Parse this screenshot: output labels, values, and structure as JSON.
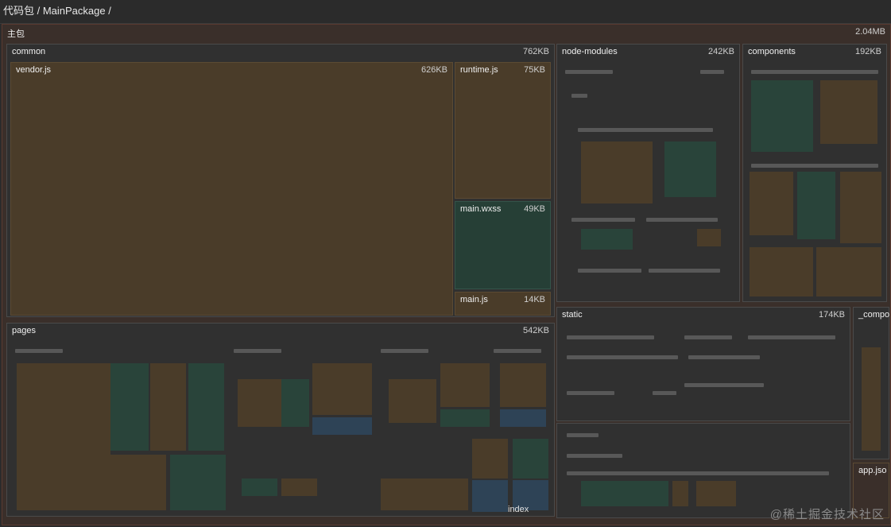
{
  "breadcrumb": "代码包 / MainPackage /",
  "root": {
    "label": "主包",
    "size": "2.04MB"
  },
  "common": {
    "label": "common",
    "size": "762KB",
    "vendor": {
      "label": "vendor.js",
      "size": "626KB"
    },
    "runtime": {
      "label": "runtime.js",
      "size": "75KB"
    },
    "mainwxss": {
      "label": "main.wxss",
      "size": "49KB"
    },
    "mainjs": {
      "label": "main.js",
      "size": "14KB"
    }
  },
  "node_modules": {
    "label": "node-modules",
    "size": "242KB"
  },
  "components": {
    "label": "components",
    "size": "192KB"
  },
  "pages": {
    "label": "pages",
    "size": "542KB"
  },
  "static": {
    "label": "static",
    "size": "174KB"
  },
  "compo": {
    "label": "_compo"
  },
  "appjson": {
    "label": "app.jso"
  },
  "index_partial": {
    "label": "index"
  },
  "watermark": "@稀土掘金技术社区",
  "colors": {
    "brown": "#4a3c29",
    "green": "#263f36",
    "blue": "#2e4356",
    "background": "#2b2b2b"
  }
}
